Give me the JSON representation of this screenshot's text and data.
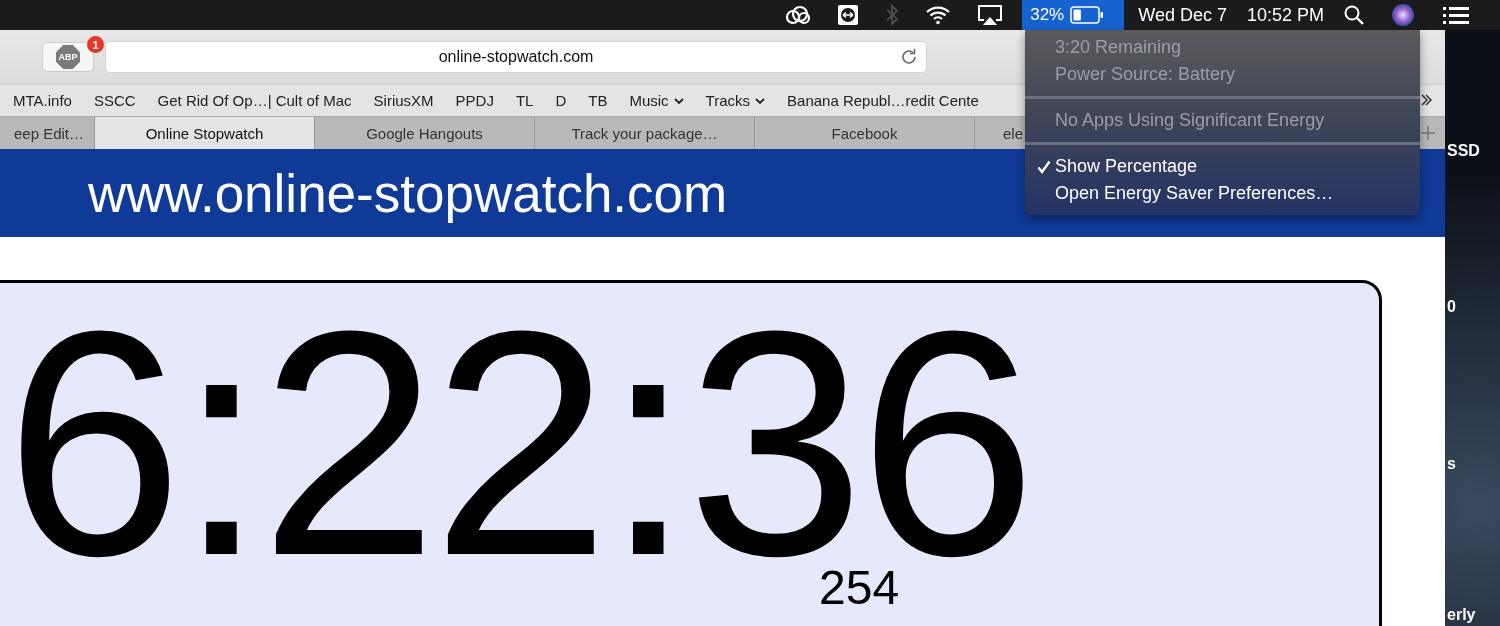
{
  "menubar": {
    "status_icons": [
      {
        "kind": "cloud",
        "dimmed": false
      },
      {
        "kind": "remote",
        "dimmed": false
      },
      {
        "kind": "bluetooth",
        "dimmed": true
      },
      {
        "kind": "wifi",
        "dimmed": false
      },
      {
        "kind": "airplay",
        "dimmed": false
      }
    ],
    "battery": {
      "percent": "32%",
      "level": 0.32,
      "selected": true
    },
    "date": "Wed Dec 7",
    "time": "10:52 PM"
  },
  "browser": {
    "adblock_badge": "1",
    "adblock_label": "ABP",
    "url": "online-stopwatch.com",
    "bookmarks": [
      {
        "label": "MTA.info",
        "kind": "link"
      },
      {
        "label": "SSCC",
        "kind": "link"
      },
      {
        "label": "Get Rid Of Op…| Cult of Mac",
        "kind": "link"
      },
      {
        "label": "SiriusXM",
        "kind": "link"
      },
      {
        "label": "PPDJ",
        "kind": "link"
      },
      {
        "label": "TL",
        "kind": "link"
      },
      {
        "label": "D",
        "kind": "link"
      },
      {
        "label": "TB",
        "kind": "link"
      },
      {
        "label": "Music",
        "kind": "folder"
      },
      {
        "label": "Tracks",
        "kind": "folder"
      },
      {
        "label": "Banana Republ…redit Cente",
        "kind": "link"
      }
    ],
    "tabs": [
      {
        "label": "eep Edit…",
        "selected": false
      },
      {
        "label": "Online Stopwatch",
        "selected": true
      },
      {
        "label": "Google Hangouts",
        "selected": false
      },
      {
        "label": "Track your package…",
        "selected": false
      },
      {
        "label": "Facebook",
        "selected": false
      },
      {
        "label": "ele",
        "selected": false
      }
    ]
  },
  "page": {
    "site_title": "www.online-stopwatch.com",
    "stopwatch": "6:22:36",
    "milliseconds": "254"
  },
  "battery_menu": {
    "sections": [
      [
        {
          "text": "3:20 Remaining",
          "disabled": true,
          "checked": false
        },
        {
          "text": "Power Source: Battery",
          "disabled": true,
          "checked": false
        }
      ],
      [
        {
          "text": "No Apps Using Significant Energy",
          "disabled": true,
          "checked": false
        }
      ],
      [
        {
          "text": "Show Percentage",
          "disabled": false,
          "checked": true
        },
        {
          "text": "Open Energy Saver Preferences…",
          "disabled": false,
          "checked": false
        }
      ]
    ]
  },
  "desktop_labels": [
    "SSD",
    "0",
    "s",
    "erly"
  ]
}
